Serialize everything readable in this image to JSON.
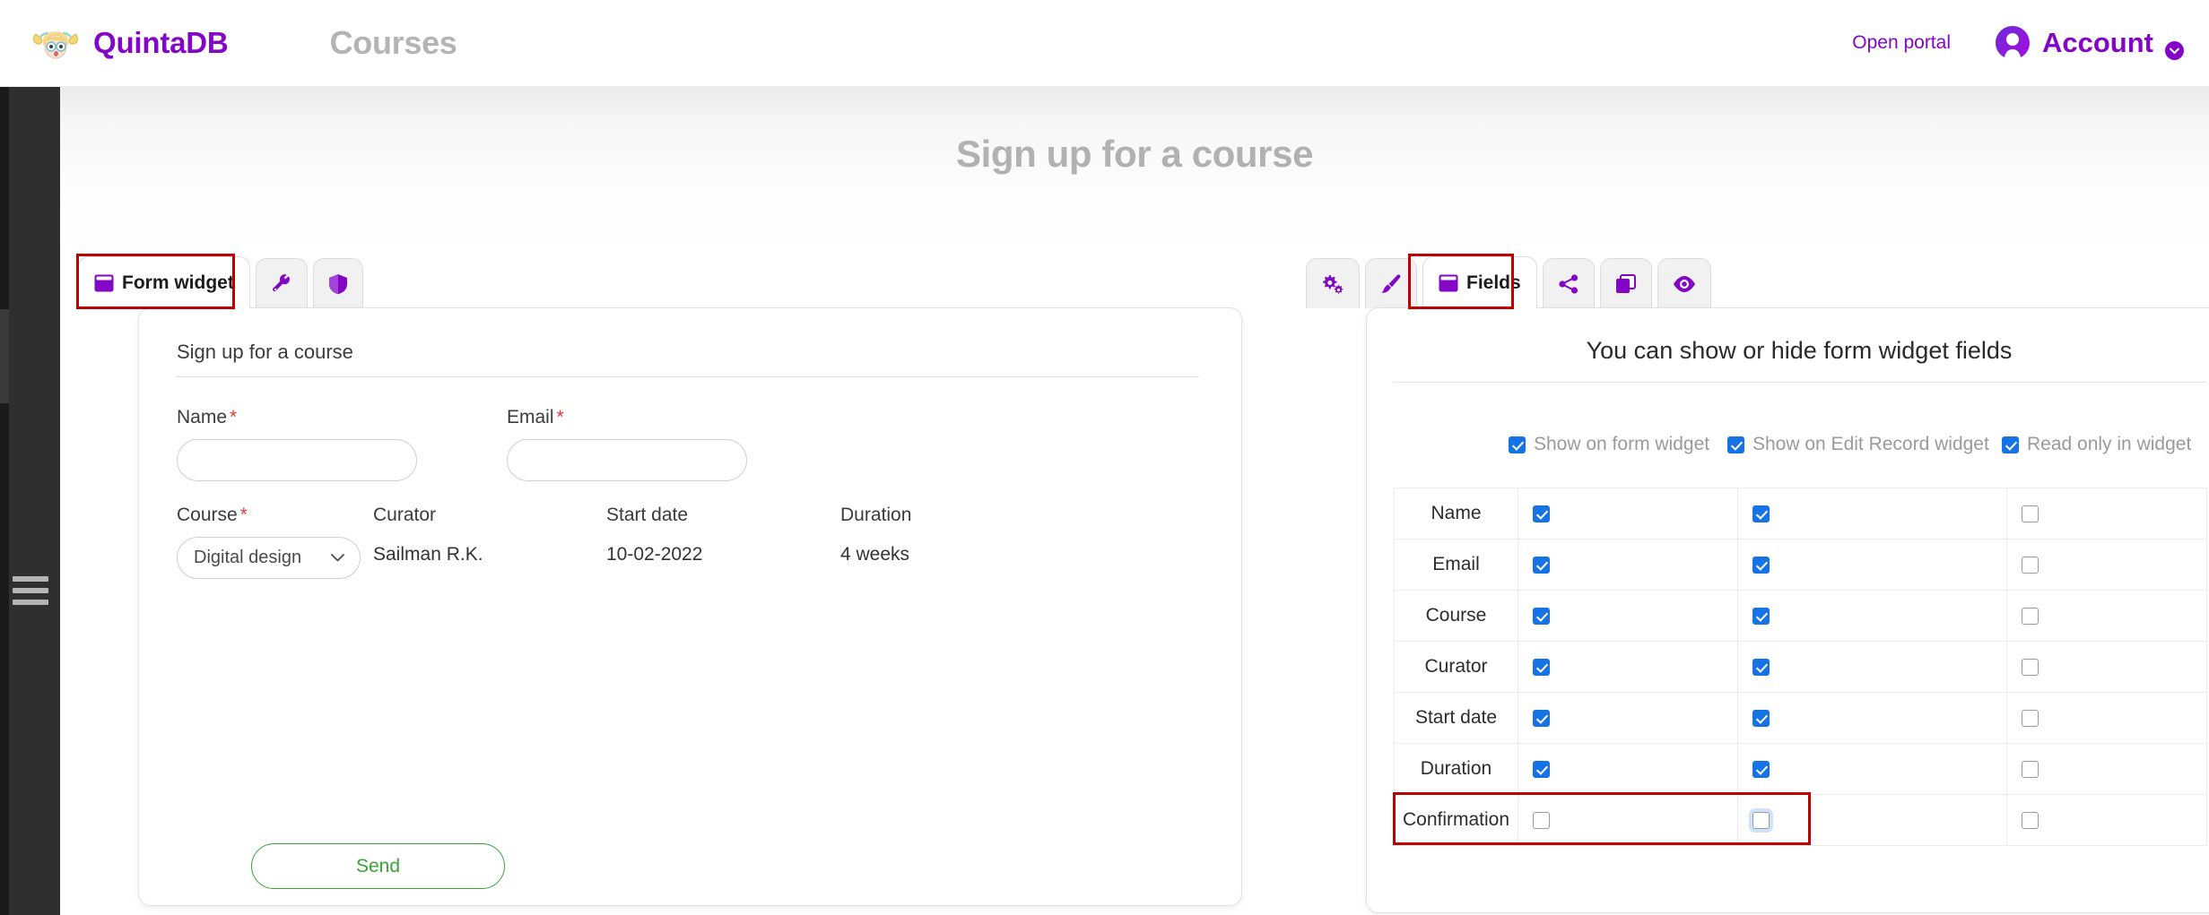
{
  "header": {
    "brand": "QuintaDB",
    "section": "Courses",
    "open_portal": "Open portal",
    "account": "Account",
    "logo_icon": "quintadb-girl-logo-icon",
    "avatar_icon": "account-avatar-icon",
    "caret_icon": "chevron-down-icon",
    "brand_color": "#8306c6",
    "section_color": "#b4b4b4"
  },
  "sidebar": {
    "toggle_icon": "hamburger-menu-icon",
    "background": "#2f2f2f"
  },
  "page": {
    "heading": "Sign up for a course"
  },
  "left_panel": {
    "tabs": [
      {
        "label": "Form widget",
        "icon": "form-widget-icon",
        "active": true,
        "highlighted": true
      },
      {
        "label": "",
        "icon": "wrench-icon",
        "active": false,
        "highlighted": false
      },
      {
        "label": "",
        "icon": "shield-icon",
        "active": false,
        "highlighted": false
      }
    ],
    "form": {
      "title": "Sign up for a course",
      "fields": {
        "name_label": "Name",
        "name_value": "",
        "name_required": "*",
        "email_label": "Email",
        "email_value": "",
        "email_required": "*",
        "course_label": "Course",
        "course_required": "*",
        "course_value": "Digital design",
        "curator_label": "Curator",
        "curator_value": "Sailman R.K.",
        "start_date_label": "Start date",
        "start_date_value": "10-02-2022",
        "duration_label": "Duration",
        "duration_value": "4 weeks"
      },
      "submit_label": "Send",
      "submit_color": "#3aa335",
      "select_caret_icon": "chevron-down-icon"
    }
  },
  "right_panel": {
    "tabs": [
      {
        "label": "",
        "icon": "gears-settings-icon",
        "active": false,
        "highlighted": false
      },
      {
        "label": "",
        "icon": "paintbrush-icon",
        "active": false,
        "highlighted": false
      },
      {
        "label": "Fields",
        "icon": "fields-icon",
        "active": true,
        "highlighted": true
      },
      {
        "label": "",
        "icon": "share-icon",
        "active": false,
        "highlighted": false
      },
      {
        "label": "",
        "icon": "copy-duplicate-icon",
        "active": false,
        "highlighted": false
      },
      {
        "label": "",
        "icon": "eye-preview-icon",
        "active": false,
        "highlighted": false
      }
    ],
    "title": "You can show or hide form widget fields",
    "columns": [
      {
        "label": "Show on form widget",
        "header_checked": true
      },
      {
        "label": "Show on Edit Record widget",
        "header_checked": true
      },
      {
        "label": "Read only in widget",
        "header_checked": true
      }
    ],
    "rows": [
      {
        "field": "Name",
        "show_form": true,
        "show_edit": true,
        "read_only": false,
        "highlighted": false,
        "focused_cell": null
      },
      {
        "field": "Email",
        "show_form": true,
        "show_edit": true,
        "read_only": false,
        "highlighted": false,
        "focused_cell": null
      },
      {
        "field": "Course",
        "show_form": true,
        "show_edit": true,
        "read_only": false,
        "highlighted": false,
        "focused_cell": null
      },
      {
        "field": "Curator",
        "show_form": true,
        "show_edit": true,
        "read_only": false,
        "highlighted": false,
        "focused_cell": null
      },
      {
        "field": "Start date",
        "show_form": true,
        "show_edit": true,
        "read_only": false,
        "highlighted": false,
        "focused_cell": null
      },
      {
        "field": "Duration",
        "show_form": true,
        "show_edit": true,
        "read_only": false,
        "highlighted": false,
        "focused_cell": null
      },
      {
        "field": "Confirmation",
        "show_form": false,
        "show_edit": false,
        "read_only": false,
        "highlighted": true,
        "focused_cell": "show_edit"
      }
    ],
    "checkbox_accent": "#1673e6"
  },
  "annotations": {
    "highlight_color": "#c00000"
  }
}
